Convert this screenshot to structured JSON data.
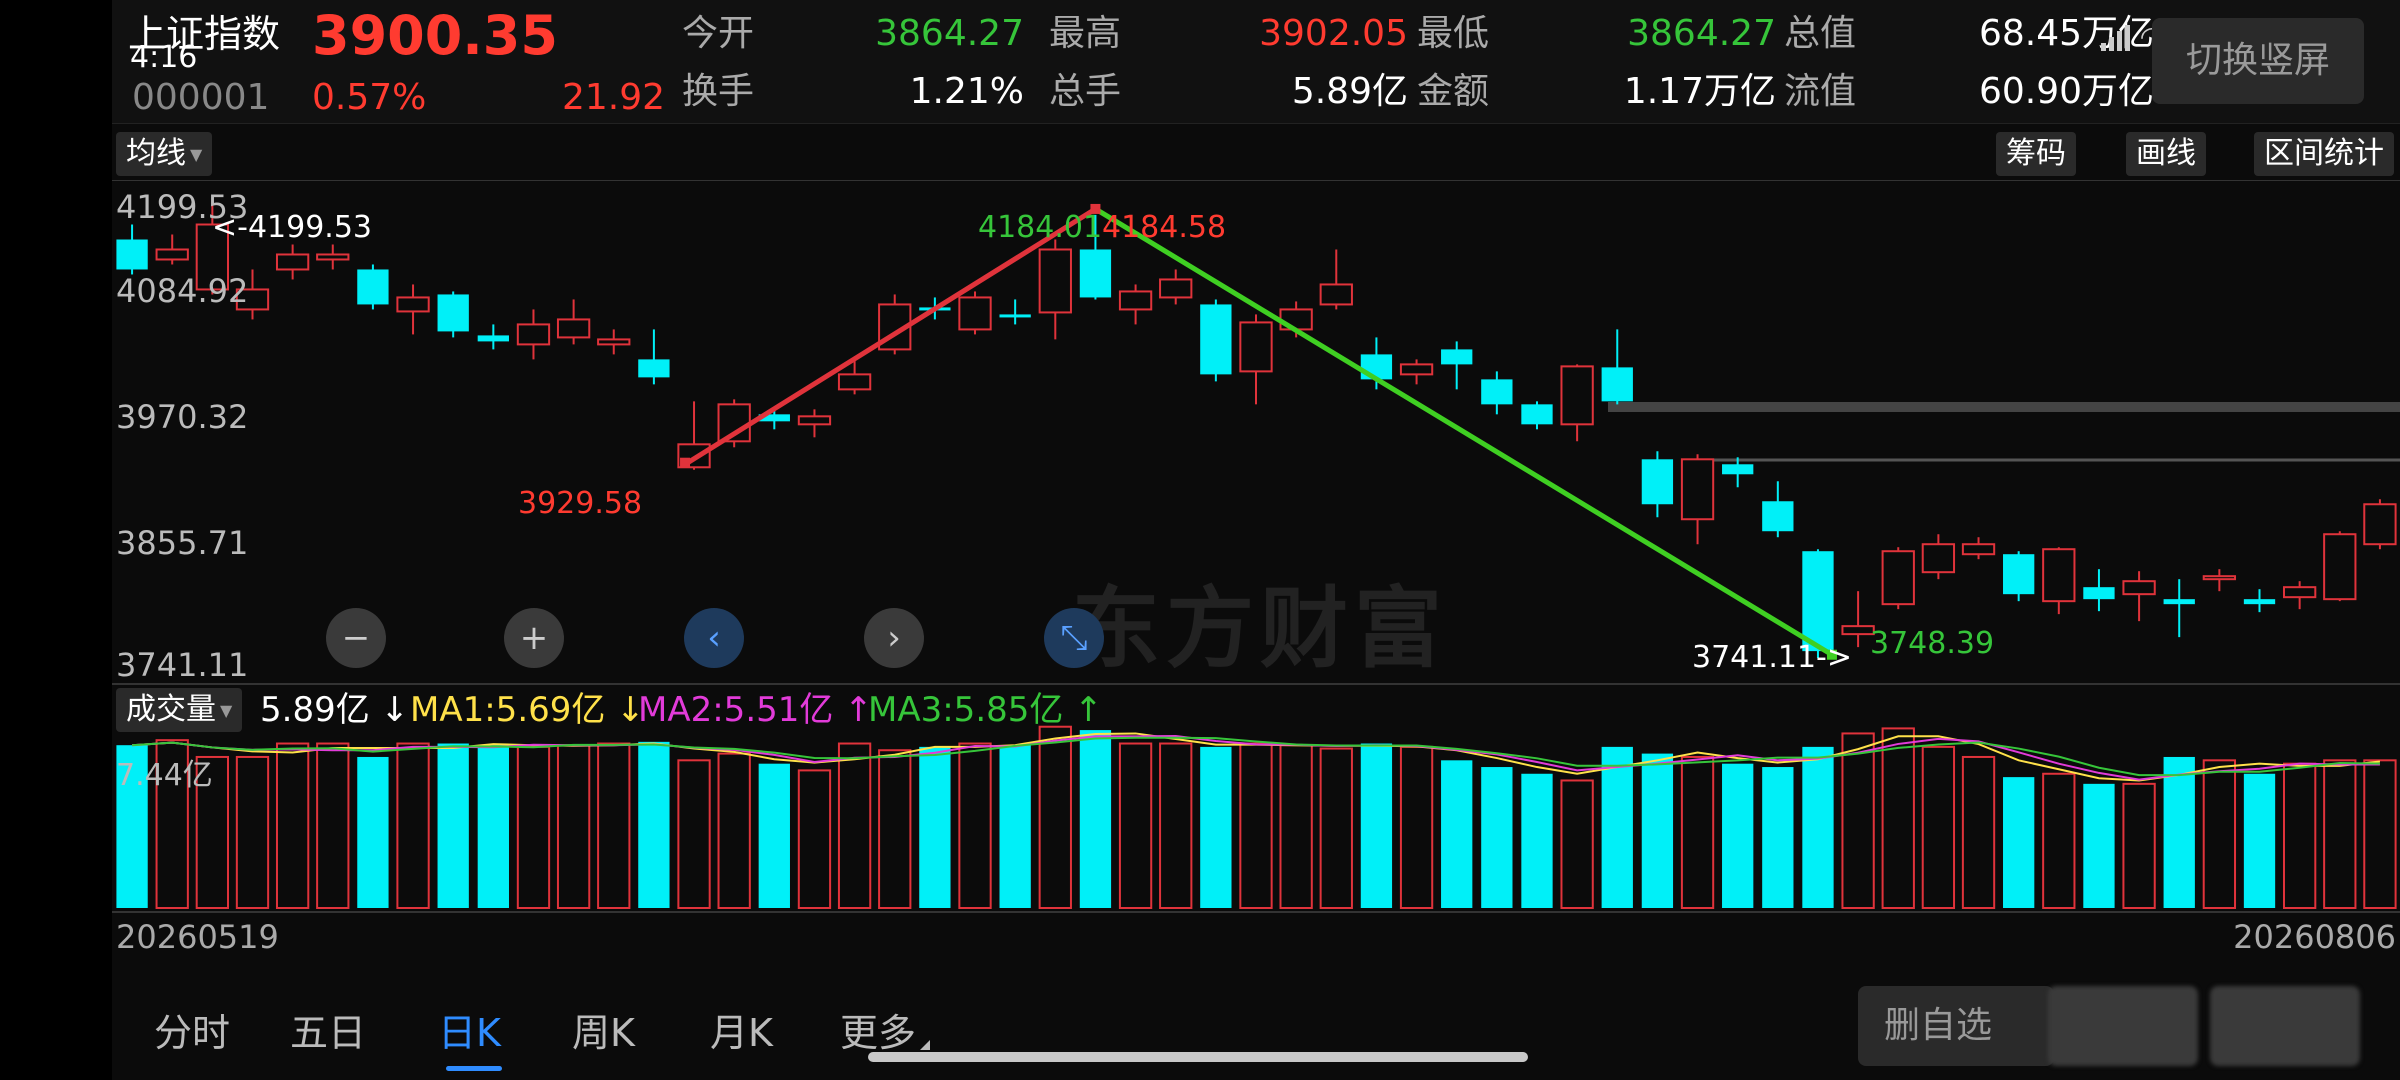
{
  "quote": {
    "name": "上证指数",
    "clock": "4:16",
    "price": "3900.35",
    "code": "000001",
    "pct": "0.57%",
    "change": "21.92",
    "fields": [
      {
        "label": "今开",
        "value": "3864.27",
        "color": "down"
      },
      {
        "label": "最高",
        "value": "3902.05",
        "color": "up"
      },
      {
        "label": "最低",
        "value": "3864.27",
        "color": "down"
      },
      {
        "label": "总值",
        "value": "68.45万亿",
        "color": "white"
      },
      {
        "label": "换手",
        "value": "1.21%",
        "color": "white"
      },
      {
        "label": "总手",
        "value": "5.89亿",
        "color": "white"
      },
      {
        "label": "金额",
        "value": "1.17万亿",
        "color": "white"
      },
      {
        "label": "流值",
        "value": "60.90万亿",
        "color": "white"
      }
    ],
    "battery": "23",
    "switch_label": "切换竖屏"
  },
  "toolbar": {
    "ma_label": "均线",
    "chip_label": "筹码",
    "draw_label": "画线",
    "range_label": "区间统计"
  },
  "chart_data": {
    "type": "candlestick",
    "y_ticks": [
      "4199.53",
      "4084.92",
      "3970.32",
      "3855.71",
      "3741.11"
    ],
    "ylim": [
      3741.11,
      4199.53
    ],
    "watermark": "东方财富",
    "annotations": {
      "max_label": "<-4199.53",
      "trend_up_start": "3929.58",
      "trend_up_end_left": "4184.01",
      "trend_up_end_right": "4184.58",
      "min_label": "3741.11->",
      "trend_down_end": "3748.39"
    },
    "candles": [
      {
        "o": 4160,
        "c": 4130,
        "h": 4175,
        "l": 4125
      },
      {
        "o": 4140,
        "c": 4150,
        "h": 4165,
        "l": 4135
      },
      {
        "o": 4110,
        "c": 4175,
        "h": 4199.53,
        "l": 4105
      },
      {
        "o": 4090,
        "c": 4110,
        "h": 4130,
        "l": 4080
      },
      {
        "o": 4130,
        "c": 4145,
        "h": 4155,
        "l": 4120
      },
      {
        "o": 4140,
        "c": 4145,
        "h": 4155,
        "l": 4130
      },
      {
        "o": 4130,
        "c": 4095,
        "h": 4135,
        "l": 4090
      },
      {
        "o": 4088,
        "c": 4102,
        "h": 4115,
        "l": 4065
      },
      {
        "o": 4105,
        "c": 4068,
        "h": 4108,
        "l": 4062
      },
      {
        "o": 4064,
        "c": 4058,
        "h": 4075,
        "l": 4050
      },
      {
        "o": 4055,
        "c": 4075,
        "h": 4090,
        "l": 4040
      },
      {
        "o": 4062,
        "c": 4080,
        "h": 4100,
        "l": 4055
      },
      {
        "o": 4055,
        "c": 4060,
        "h": 4070,
        "l": 4045
      },
      {
        "o": 4040,
        "c": 4022,
        "h": 4070,
        "l": 4015
      },
      {
        "o": 3932,
        "c": 3955,
        "h": 3998,
        "l": 3929.58
      },
      {
        "o": 3958,
        "c": 3995,
        "h": 4000,
        "l": 3952
      },
      {
        "o": 3985,
        "c": 3978,
        "h": 3992,
        "l": 3970
      },
      {
        "o": 3975,
        "c": 3983,
        "h": 3990,
        "l": 3962
      },
      {
        "o": 4010,
        "c": 4025,
        "h": 4040,
        "l": 4005
      },
      {
        "o": 4050,
        "c": 4095,
        "h": 4105,
        "l": 4045
      },
      {
        "o": 4092,
        "c": 4090,
        "h": 4102,
        "l": 4080
      },
      {
        "o": 4070,
        "c": 4102,
        "h": 4108,
        "l": 4065
      },
      {
        "o": 4085,
        "c": 4083,
        "h": 4100,
        "l": 4075
      },
      {
        "o": 4087,
        "c": 4150,
        "h": 4160,
        "l": 4060
      },
      {
        "o": 4150,
        "c": 4102,
        "h": 4184.58,
        "l": 4100
      },
      {
        "o": 4090,
        "c": 4108,
        "h": 4115,
        "l": 4075
      },
      {
        "o": 4102,
        "c": 4120,
        "h": 4130,
        "l": 4095
      },
      {
        "o": 4095,
        "c": 4025,
        "h": 4100,
        "l": 4018
      },
      {
        "o": 4028,
        "c": 4077,
        "h": 4085,
        "l": 3995
      },
      {
        "o": 4070,
        "c": 4090,
        "h": 4098,
        "l": 4062
      },
      {
        "o": 4095,
        "c": 4115,
        "h": 4150,
        "l": 4090
      },
      {
        "o": 4045,
        "c": 4020,
        "h": 4062,
        "l": 4010
      },
      {
        "o": 4025,
        "c": 4035,
        "h": 4040,
        "l": 4015
      },
      {
        "o": 4050,
        "c": 4035,
        "h": 4058,
        "l": 4010
      },
      {
        "o": 4020,
        "c": 3995,
        "h": 4028,
        "l": 3985
      },
      {
        "o": 3995,
        "c": 3975,
        "h": 3998,
        "l": 3970
      },
      {
        "o": 3975,
        "c": 4033,
        "h": 4035,
        "l": 3958
      },
      {
        "o": 4032,
        "c": 3998,
        "h": 4070,
        "l": 3995
      },
      {
        "o": 3940,
        "c": 3895,
        "h": 3948,
        "l": 3882
      },
      {
        "o": 3880,
        "c": 3940,
        "h": 3945,
        "l": 3855
      },
      {
        "o": 3935,
        "c": 3925,
        "h": 3942,
        "l": 3912
      },
      {
        "o": 3898,
        "c": 3868,
        "h": 3918,
        "l": 3862
      },
      {
        "o": 3848,
        "c": 3748,
        "h": 3850,
        "l": 3741.11
      },
      {
        "o": 3765,
        "c": 3773,
        "h": 3808,
        "l": 3752
      },
      {
        "o": 3795,
        "c": 3848,
        "h": 3852,
        "l": 3790
      },
      {
        "o": 3827,
        "c": 3855,
        "h": 3865,
        "l": 3820
      },
      {
        "o": 3845,
        "c": 3855,
        "h": 3862,
        "l": 3840
      },
      {
        "o": 3845,
        "c": 3805,
        "h": 3848,
        "l": 3798
      },
      {
        "o": 3798,
        "c": 3850,
        "h": 3852,
        "l": 3785
      },
      {
        "o": 3812,
        "c": 3800,
        "h": 3830,
        "l": 3788
      },
      {
        "o": 3805,
        "c": 3818,
        "h": 3828,
        "l": 3778
      },
      {
        "o": 3800,
        "c": 3795,
        "h": 3820,
        "l": 3762
      },
      {
        "o": 3820,
        "c": 3823,
        "h": 3830,
        "l": 3808
      },
      {
        "o": 3800,
        "c": 3795,
        "h": 3810,
        "l": 3787
      },
      {
        "o": 3802,
        "c": 3812,
        "h": 3818,
        "l": 3790
      },
      {
        "o": 3800,
        "c": 3865,
        "h": 3868,
        "l": 3798
      },
      {
        "o": 3855,
        "c": 3895,
        "h": 3900,
        "l": 3850
      }
    ],
    "volume_levels": [
      0.85,
      0.88,
      0.78,
      0.78,
      0.86,
      0.86,
      0.78,
      0.86,
      0.86,
      0.85,
      0.84,
      0.85,
      0.86,
      0.87,
      0.76,
      0.8,
      0.74,
      0.7,
      0.86,
      0.82,
      0.84,
      0.86,
      0.85,
      0.96,
      0.94,
      0.86,
      0.86,
      0.84,
      0.86,
      0.85,
      0.83,
      0.86,
      0.84,
      0.76,
      0.72,
      0.68,
      0.64,
      0.84,
      0.8,
      0.78,
      0.74,
      0.72,
      0.84,
      0.92,
      0.95,
      0.84,
      0.78,
      0.66,
      0.68,
      0.62,
      0.62,
      0.78,
      0.76,
      0.68,
      0.74,
      0.76,
      0.76
    ],
    "volume_top_tick": "7.44亿",
    "start_date": "20260519",
    "end_date": "20260806"
  },
  "volume": {
    "title": "成交量",
    "value": "5.89亿",
    "arrow_value": "↓",
    "ma1": "MA1:5.69亿",
    "ma1_arrow": "↓",
    "ma2": "MA2:5.51亿",
    "ma2_arrow": "↑",
    "ma3": "MA3:5.85亿",
    "ma3_arrow": "↑",
    "colors": {
      "ma1": "#ffe14a",
      "ma2": "#e23bd9",
      "ma3": "#36c53a"
    }
  },
  "controls": {
    "zoom_out": "−",
    "zoom_in": "+",
    "prev": "‹",
    "next": "›",
    "shrink": "⤡"
  },
  "tabs": [
    "分时",
    "五日",
    "日K",
    "周K",
    "月K",
    "更多"
  ],
  "active_tab": 2,
  "delete_label": "删自选"
}
